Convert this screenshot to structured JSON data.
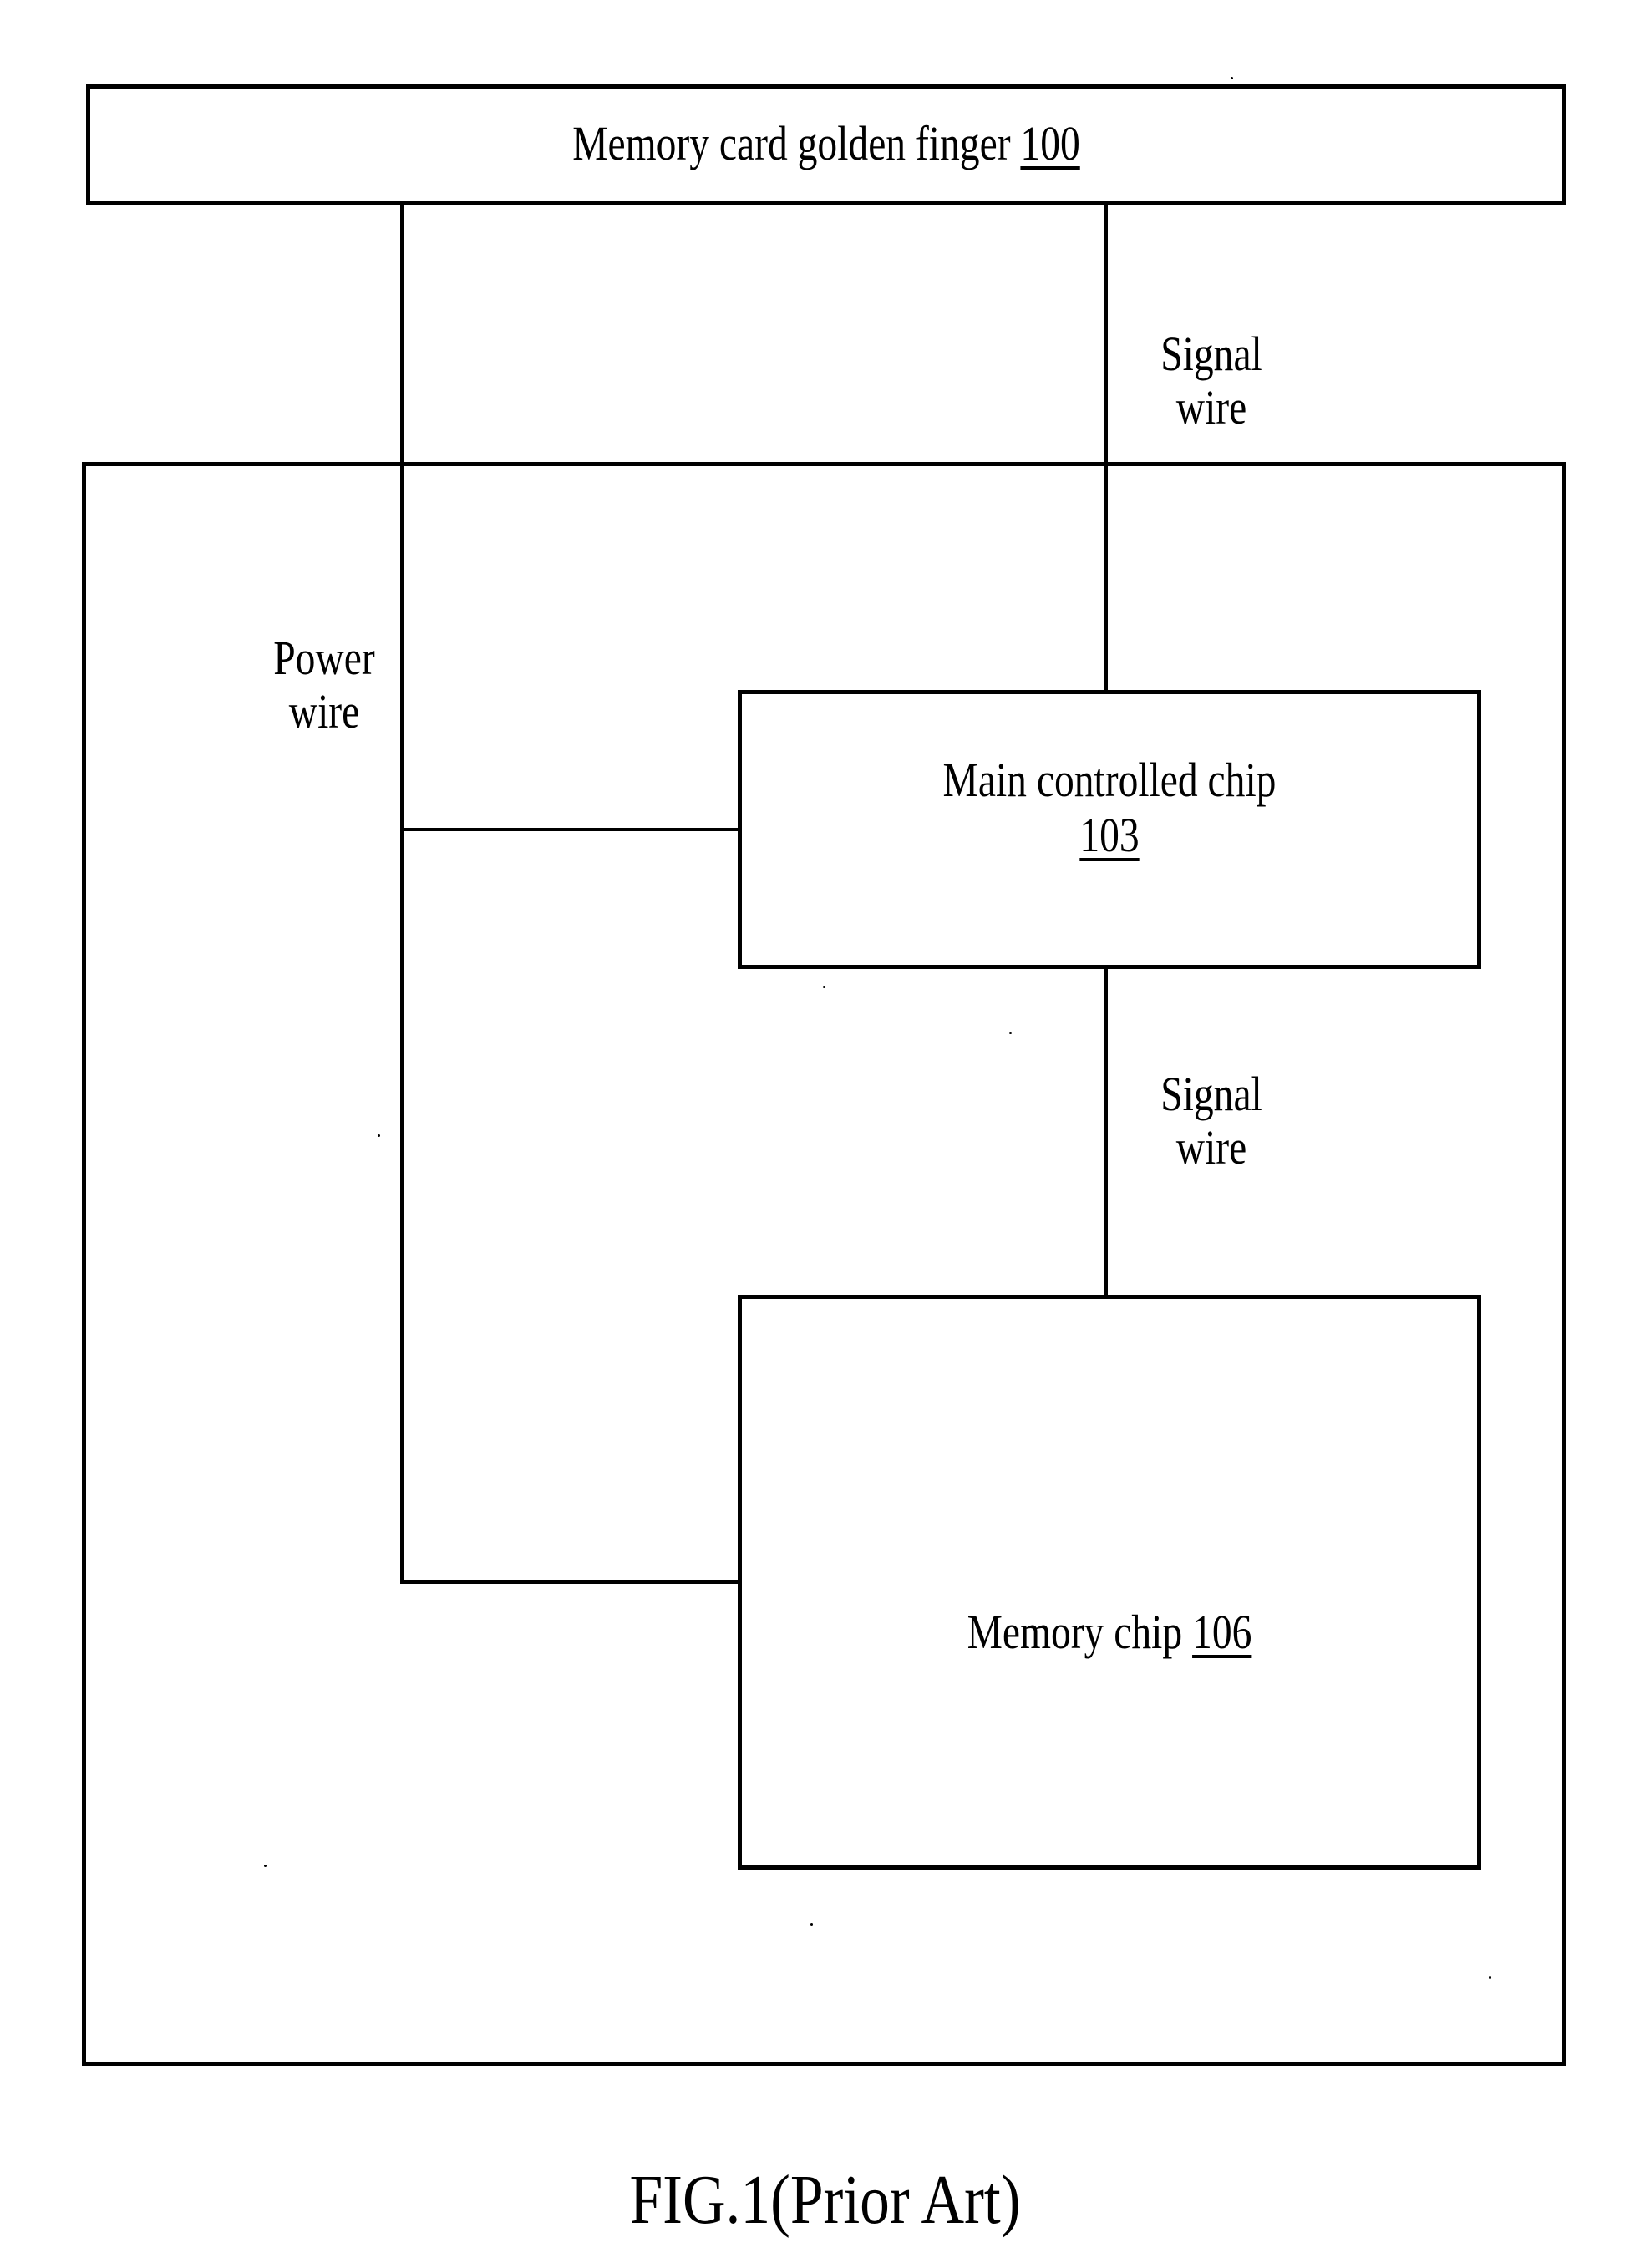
{
  "figure": {
    "caption": "FIG.1(Prior Art)"
  },
  "blocks": {
    "golden_finger": {
      "label": "Memory card golden finger",
      "ref": "100"
    },
    "main_chip": {
      "label": "Main controlled chip",
      "ref": "103"
    },
    "memory_chip": {
      "label": "Memory chip",
      "ref": "106"
    }
  },
  "wires": {
    "power": {
      "line1": "Power",
      "line2": "wire"
    },
    "signal_top": {
      "line1": "Signal",
      "line2": "wire"
    },
    "signal_bottom": {
      "line1": "Signal",
      "line2": "wire"
    }
  }
}
